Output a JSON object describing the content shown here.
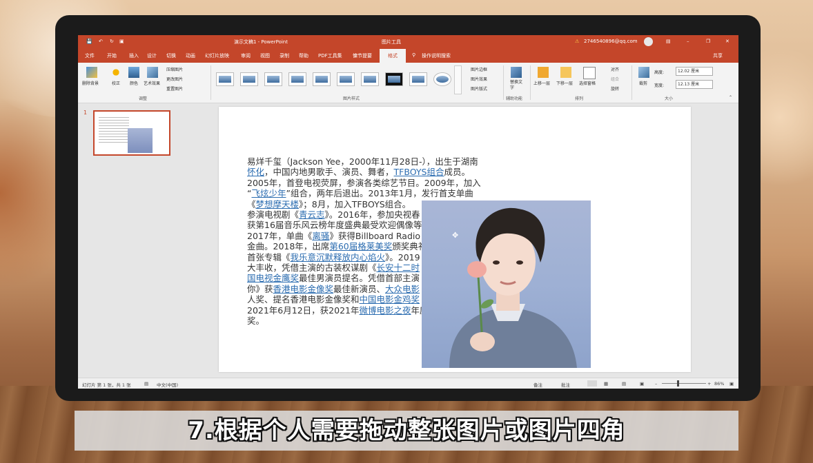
{
  "window": {
    "doc_title": "演示文稿1 - PowerPoint",
    "context_tab": "图片工具",
    "account": "2746540896@qq.com",
    "share": "共享"
  },
  "menu": {
    "items": [
      "文件",
      "开始",
      "插入",
      "设计",
      "切换",
      "动画",
      "幻灯片放映",
      "审阅",
      "视图",
      "录制",
      "帮助",
      "PDF工具集",
      "慵节提要"
    ],
    "active": "格式",
    "tell_me": "操作说明搜索"
  },
  "ribbon": {
    "adjust": {
      "remove_bg": "删除背景",
      "corrections": "校正",
      "color": "颜色",
      "artistic": "艺术效果",
      "compress": "压缩图片",
      "change": "更改图片",
      "reset": "重置图片",
      "label": "调整"
    },
    "styles": {
      "border": "图片边框",
      "effects": "图片效果",
      "layout": "图片版式",
      "label": "图片样式"
    },
    "accessibility": {
      "alt_text": "替换文字",
      "label": "辅助功能"
    },
    "arrange": {
      "forward": "上移一层",
      "backward": "下移一层",
      "selection": "选择窗格",
      "align": "对齐",
      "group": "组合",
      "rotate": "旋转",
      "label": "排列"
    },
    "size": {
      "crop": "裁剪",
      "height_label": "高度:",
      "height": "12.02 厘米",
      "width_label": "宽度:",
      "width": "12.13 厘米",
      "label": "大小"
    }
  },
  "thumbs": {
    "slide_number": "1"
  },
  "slide_text": {
    "l1": "易烊千玺（Jackson Yee，2000年11月28日-），出生于湖南",
    "l2a": "怀化",
    "l2b": "，中国内地男歌手、演员、舞者，",
    "l2c": "TFBOYS组合",
    "l2d": "成员。",
    "l3": "2005年，首登电视荧屏，参演各类综艺节目。2009年，加入",
    "l4a": "“",
    "l4b": "飞炫少年",
    "l4c": "”组合，两年后退出。2013年1月，发行首支单曲",
    "l5a": "《",
    "l5b": "梦想摩天楼",
    "l5c": "》；8月，加入TFBOYS组合。",
    "l6a": "参演电视剧《",
    "l6b": "青云志",
    "l6c": "》。2016年，参加央视春",
    "l7": "获第16届音乐风云榜年度盛典最受欢迎偶像等",
    "l8a": "2017年，单曲《",
    "l8b": "离骚",
    "l8c": "》获得Billboard Radio C",
    "l9a": "金曲。2018年，出席",
    "l9b": "第60届格莱美奖",
    "l9c": "颁奖典礼",
    "l10a": "首张专辑《",
    "l10b": "我乐意沉默释放内心焰火",
    "l10c": "》。2019",
    "l11a": "大丰收，凭借主演的古装权谋剧《",
    "l11b": "长安十二时",
    "l12a": "国电视金鹰奖",
    "l12b": "最佳男演员提名。凭借首部主演",
    "l13a": "你》获",
    "l13b": "香港电影金像奖",
    "l13c": "最佳新演员、",
    "l13d": "大众电影",
    "l14a": "人奖、提名香港电影金像奖和",
    "l14b": "中国电影金鸡奖",
    "l15a": "2021年6月12日，获2021年",
    "l15b": "微博电影之夜",
    "l15c": "年度",
    "l16": "奖。"
  },
  "status": {
    "slide_info": "幻灯片 第 1 张，共 1 张",
    "language": "中文(中国)",
    "notes": "备注",
    "comments": "批注",
    "zoom": "86%"
  },
  "caption": "7.根据个人需要拖动整张图片或图片四角",
  "colors": {
    "accent": "#c4462a",
    "link": "#2b6cb0"
  }
}
